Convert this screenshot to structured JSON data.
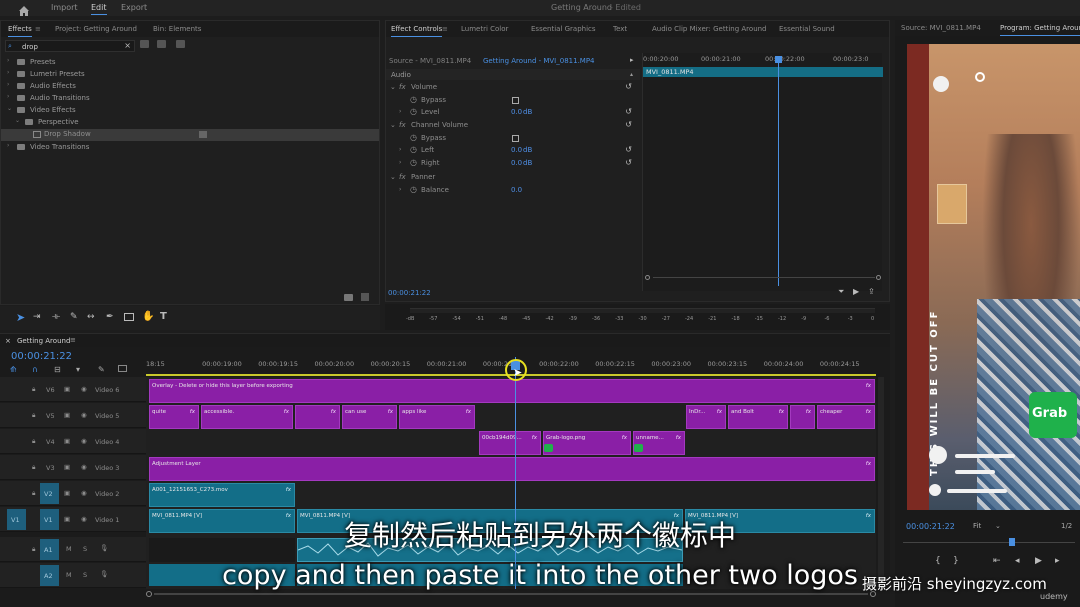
{
  "topbar": {
    "home_icon": "home-icon",
    "workspaces": [
      "Import",
      "Edit",
      "Export"
    ],
    "active": "Edit",
    "title": "Getting Around",
    "status": "- Edited"
  },
  "effects_panel": {
    "tabs": [
      "Effects",
      "Project: Getting Around",
      "Bin: Elements"
    ],
    "search_value": "drop",
    "items": [
      {
        "label": "Presets",
        "level": 0
      },
      {
        "label": "Lumetri Presets",
        "level": 0
      },
      {
        "label": "Audio Effects",
        "level": 0
      },
      {
        "label": "Audio Transitions",
        "level": 0
      },
      {
        "label": "Video Effects",
        "level": 0
      },
      {
        "label": "Perspective",
        "level": 1
      },
      {
        "label": "Drop Shadow",
        "level": 2
      },
      {
        "label": "Video Transitions",
        "level": 0
      }
    ]
  },
  "effect_controls": {
    "tabs": [
      "Effect Controls",
      "Lumetri Color",
      "Essential Graphics",
      "Text",
      "Audio Clip Mixer: Getting Around",
      "Essential Sound"
    ],
    "source": "Source - MVI_0811.MP4",
    "sequence": "Getting Around - MVI_0811.MP4",
    "section": "Audio",
    "rows": [
      {
        "label": "Volume",
        "kind": "fx",
        "value": ""
      },
      {
        "label": "Bypass",
        "kind": "check",
        "value": ""
      },
      {
        "label": "Level",
        "kind": "param",
        "value": "0.0",
        "unit": "dB"
      },
      {
        "label": "Channel Volume",
        "kind": "fx",
        "value": ""
      },
      {
        "label": "Bypass",
        "kind": "check",
        "value": ""
      },
      {
        "label": "Left",
        "kind": "param",
        "value": "0.0",
        "unit": "dB"
      },
      {
        "label": "Right",
        "kind": "param",
        "value": "0.0",
        "unit": "dB"
      },
      {
        "label": "Panner",
        "kind": "fx",
        "value": ""
      },
      {
        "label": "Balance",
        "kind": "param",
        "value": "0.0",
        "unit": ""
      }
    ],
    "ruler": [
      "0:00:20:00",
      "00:00:21:00",
      "00:00:22:00",
      "00:00:23:0"
    ],
    "clip_label": "MVI_0811.MP4",
    "timecode": "00:00:21:22"
  },
  "audio_meter": {
    "ticks": [
      "-dB",
      "-57",
      "-54",
      "-51",
      "-48",
      "-45",
      "-42",
      "-39",
      "-36",
      "-33",
      "-30",
      "-27",
      "-24",
      "-21",
      "-18",
      "-15",
      "-12",
      "-9",
      "-6",
      "-3",
      "0"
    ]
  },
  "timeline": {
    "tab": "Getting Around",
    "timecode": "00:00:21:22",
    "ruler": [
      "18:15",
      "00:00:19:00",
      "00:00:19:15",
      "00:00:20:00",
      "00:00:20:15",
      "00:00:21:00",
      "00:00:21:1",
      "00:00:22:00",
      "00:00:22:15",
      "00:00:23:00",
      "00:00:23:15",
      "00:00:24:00",
      "00:00:24:15"
    ],
    "tracks": [
      {
        "id": "V6",
        "name": "Video 6"
      },
      {
        "id": "V5",
        "name": "Video 5"
      },
      {
        "id": "V4",
        "name": "Video 4"
      },
      {
        "id": "V3",
        "name": "Video 3"
      },
      {
        "id": "V2",
        "name": "Video 2"
      },
      {
        "id": "V1",
        "name": "Video 1",
        "src": "V1"
      },
      {
        "id": "A1",
        "name": "",
        "src": "A1"
      },
      {
        "id": "A2",
        "name": "",
        "src": ""
      }
    ],
    "clips": {
      "v6": "Overlay - Delete or hide this layer before exporting",
      "v5": [
        "quite",
        "accessible.",
        "can use",
        "apps like",
        "InDr...",
        "and Bolt",
        "cheaper"
      ],
      "v4": [
        "00cb194d09...",
        "Grab-logo.png",
        "unname..."
      ],
      "v3": "Adjustment Layer",
      "v2": "A001_12151653_C273.mov",
      "v1": [
        "MVI_0811.MP4 [V]",
        "MVI_0811.MP4 [V]",
        "MVI_0811.MP4 [V]"
      ]
    }
  },
  "program": {
    "tabs": [
      "Source: MVI_0811.MP4",
      "Program: Getting Around"
    ],
    "vertical_text": "THIS WILL BE CUT OFF",
    "grab_logo": "Grab",
    "timecode": "00:00:21:22",
    "fit": "Fit",
    "resolution": "1/2"
  },
  "subtitles": {
    "cn": "复制然后粘贴到另外两个徽标中",
    "en": "copy and then paste it into the other two logos"
  },
  "watermark": {
    "text": "摄影前沿 sheyingzyz.com",
    "udemy": "udemy"
  }
}
